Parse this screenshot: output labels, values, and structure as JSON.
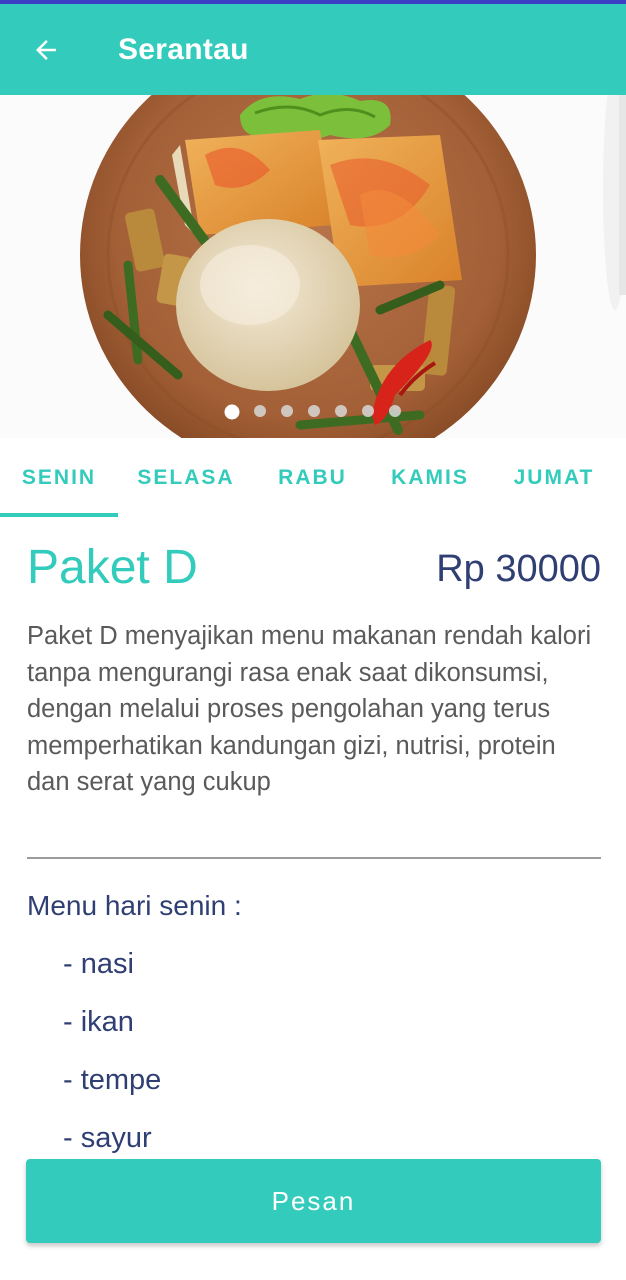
{
  "app_bar": {
    "title": "Serantau",
    "back_icon": "arrow-left-icon",
    "background": "#33cbbb"
  },
  "carousel": {
    "image": "food-plate-rice-tempe-tofu",
    "page_count": 7,
    "active_page": 1
  },
  "tabs": {
    "items": [
      {
        "label": "SENIN"
      },
      {
        "label": "SELASA"
      },
      {
        "label": "RABU"
      },
      {
        "label": "KAMIS"
      },
      {
        "label": "JUMAT"
      }
    ],
    "active_index": 0
  },
  "package": {
    "title": "Paket D",
    "price": "Rp 30000",
    "description": "Paket D menyajikan menu makanan rendah kalori tanpa mengurangi rasa enak saat dikonsumsi, dengan melalui proses pengolahan yang terus memperhatikan kandungan gizi, nutrisi, protein dan serat yang cukup"
  },
  "menu": {
    "heading": "Menu hari senin :",
    "items": [
      "- nasi",
      "- ikan",
      "- tempe",
      "- sayur"
    ]
  },
  "order_button": {
    "label": "Pesan"
  },
  "colors": {
    "accent": "#33cbbb",
    "navy_text": "#2f3e73",
    "body_text": "#5a5a5a"
  }
}
